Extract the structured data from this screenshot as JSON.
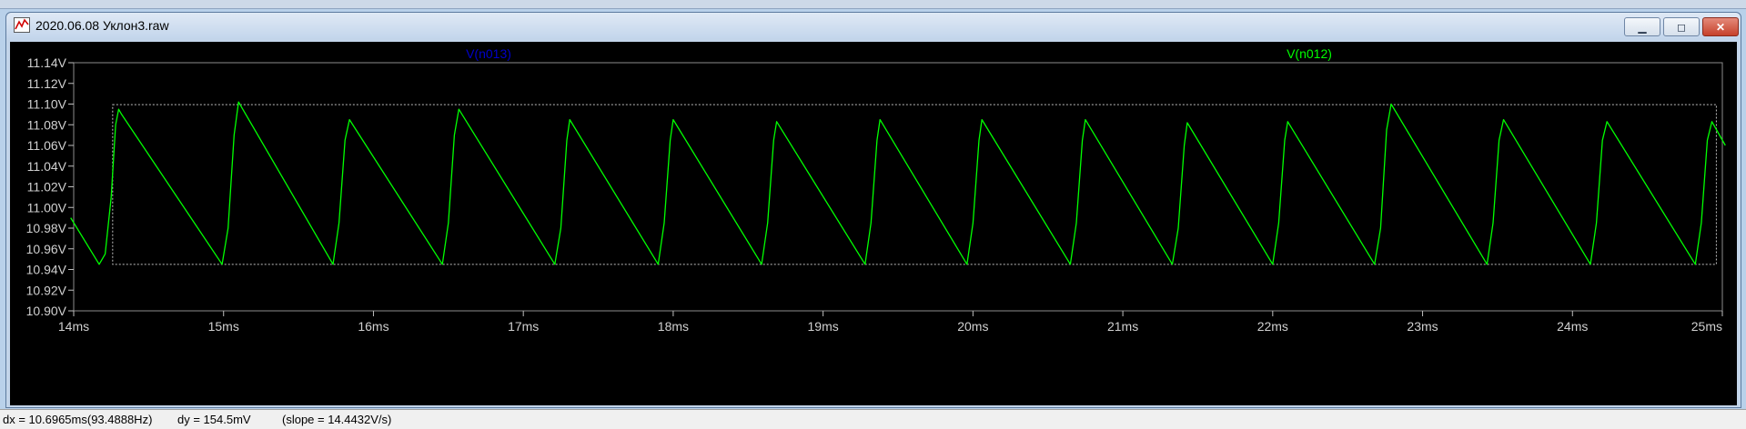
{
  "window": {
    "title": "2020.06.08 Уклон3.raw",
    "minimize_label": "▁",
    "maximize_label": "◻",
    "close_label": "✕"
  },
  "chart_data": {
    "type": "line",
    "series": [
      {
        "name": "V(n012)",
        "color": "#00ff00",
        "x": [
          13.98,
          14.17,
          14.21,
          14.25,
          14.28,
          14.3,
          14.32,
          14.99,
          15.03,
          15.07,
          15.1,
          15.73,
          15.77,
          15.81,
          15.84,
          16.46,
          16.5,
          16.54,
          16.57,
          17.21,
          17.25,
          17.29,
          17.31,
          17.9,
          17.94,
          17.98,
          18.0,
          18.59,
          18.63,
          18.67,
          18.69,
          19.28,
          19.32,
          19.36,
          19.38,
          19.96,
          20.0,
          20.04,
          20.06,
          20.65,
          20.69,
          20.73,
          20.75,
          21.33,
          21.37,
          21.41,
          21.43,
          22.0,
          22.04,
          22.08,
          22.1,
          22.68,
          22.72,
          22.76,
          22.79,
          23.43,
          23.47,
          23.51,
          23.54,
          24.12,
          24.16,
          24.2,
          24.23,
          24.82,
          24.86,
          24.9,
          24.93,
          25.02
        ],
        "y": [
          10.99,
          10.945,
          10.955,
          11.01,
          11.08,
          11.095,
          11.09,
          10.945,
          10.98,
          11.07,
          11.102,
          10.945,
          10.985,
          11.065,
          11.085,
          10.945,
          10.985,
          11.07,
          11.095,
          10.945,
          10.98,
          11.065,
          11.085,
          10.945,
          10.985,
          11.065,
          11.085,
          10.945,
          10.985,
          11.065,
          11.083,
          10.945,
          10.985,
          11.065,
          11.085,
          10.945,
          10.985,
          11.065,
          11.085,
          10.945,
          10.985,
          11.065,
          11.085,
          10.945,
          10.98,
          11.06,
          11.082,
          10.945,
          10.985,
          11.065,
          11.083,
          10.945,
          10.98,
          11.075,
          11.1,
          10.945,
          10.985,
          11.065,
          11.085,
          10.945,
          10.985,
          11.065,
          11.083,
          10.945,
          10.985,
          11.065,
          11.083,
          11.06
        ]
      }
    ],
    "legend_labels": [
      {
        "label": "V(n013)",
        "color": "#0000cc"
      },
      {
        "label": "V(n012)",
        "color": "#00ff00"
      }
    ],
    "y_ticks": [
      "11.14V",
      "11.12V",
      "11.10V",
      "11.08V",
      "11.06V",
      "11.04V",
      "11.02V",
      "11.00V",
      "10.98V",
      "10.96V",
      "10.94V",
      "10.92V",
      "10.90V"
    ],
    "x_ticks": [
      "14ms",
      "15ms",
      "16ms",
      "17ms",
      "18ms",
      "19ms",
      "20ms",
      "21ms",
      "22ms",
      "23ms",
      "24ms",
      "25ms"
    ],
    "xlim": [
      14,
      25
    ],
    "ylim": [
      10.9,
      11.14
    ],
    "cursor_box": {
      "x": [
        14.26,
        24.96
      ],
      "y": [
        10.945,
        11.0995
      ]
    },
    "grid": false
  },
  "status": {
    "dx": "dx = 10.6965ms(93.4888Hz)",
    "dy": "dy = 154.5mV",
    "slope": "(slope = 14.4432V/s)"
  }
}
